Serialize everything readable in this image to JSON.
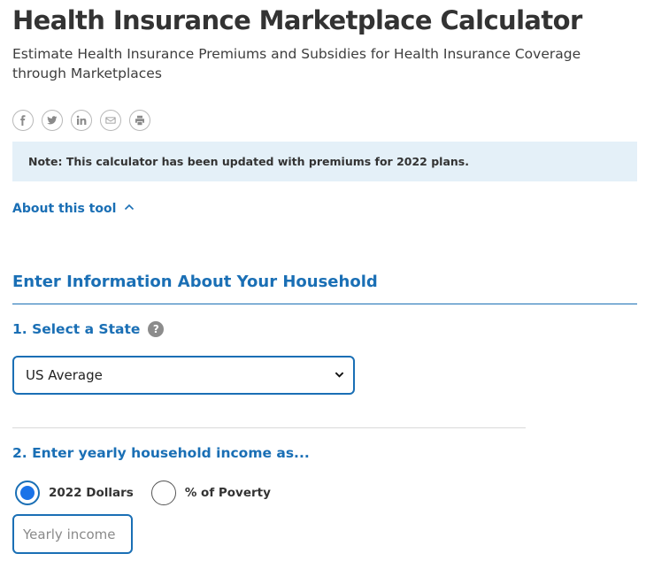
{
  "header": {
    "title": "Health Insurance Marketplace Calculator",
    "subtitle": "Estimate Health Insurance Premiums and Subsidies for Health Insurance Coverage through Marketplaces"
  },
  "share": {
    "icons": [
      "facebook-icon",
      "twitter-icon",
      "linkedin-icon",
      "email-icon",
      "print-icon"
    ]
  },
  "note": {
    "text": "Note: This calculator has been updated with premiums for 2022 plans."
  },
  "about": {
    "label": "About this tool",
    "icon": "chevron-up-icon"
  },
  "household": {
    "heading": "Enter Information About Your Household",
    "state_label": "1. Select a State",
    "help_icon_text": "?",
    "state_selected": "US Average",
    "income_label": "2. Enter yearly household income as...",
    "income_options": [
      {
        "label": "2022 Dollars",
        "checked": true
      },
      {
        "label": "% of Poverty",
        "checked": false
      }
    ],
    "income_placeholder": "Yearly income"
  },
  "colors": {
    "accent": "#1a6fb5",
    "note_bg": "#e4f0f8",
    "radio_fill": "#1a73e8",
    "help_icon_bg": "#8c8c8c"
  }
}
